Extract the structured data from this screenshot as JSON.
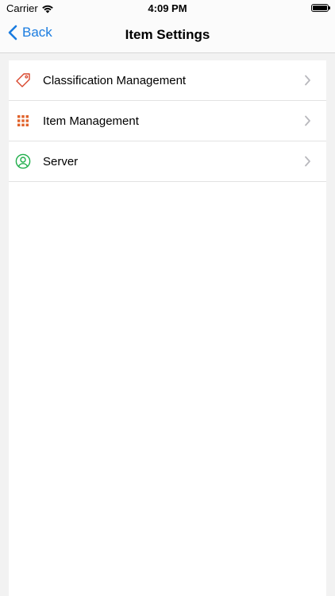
{
  "status_bar": {
    "carrier": "Carrier",
    "time": "4:09 PM"
  },
  "nav": {
    "back_label": "Back",
    "title": "Item Settings"
  },
  "rows": [
    {
      "label": "Classification Management",
      "icon": "tag-icon",
      "color": "#d9462c"
    },
    {
      "label": "Item Management",
      "icon": "grid-icon",
      "color": "#e0622a"
    },
    {
      "label": "Server",
      "icon": "user-circle-icon",
      "color": "#1fae4a"
    }
  ],
  "colors": {
    "accent": "#1a7ce0",
    "chevron": "#b8b8bd"
  }
}
